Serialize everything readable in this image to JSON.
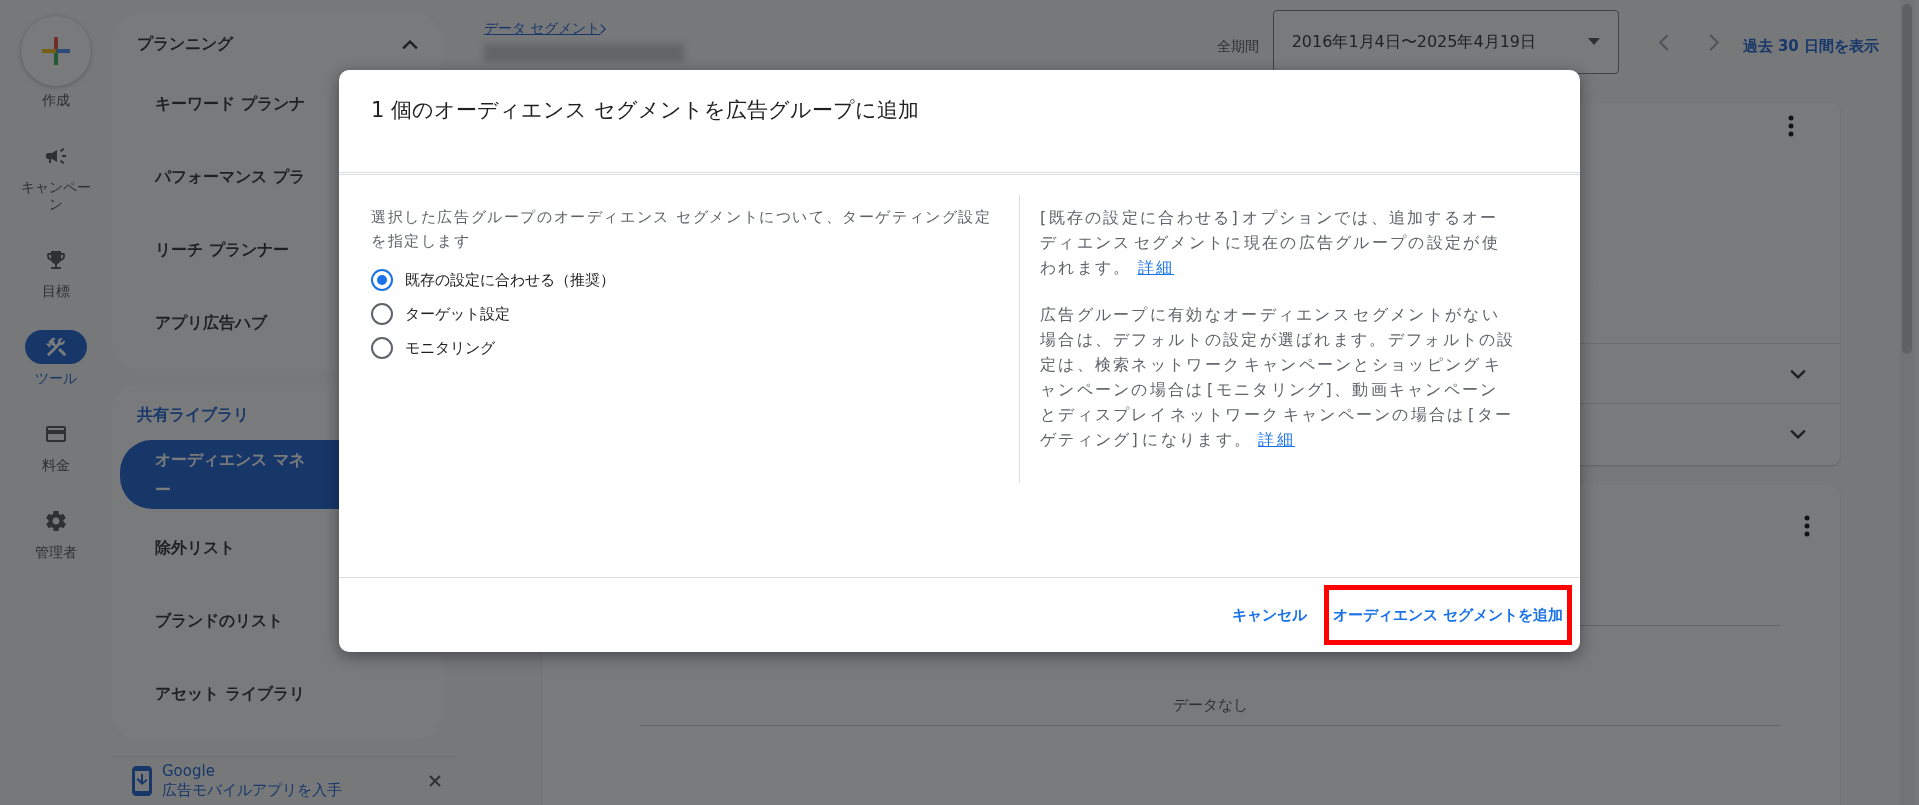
{
  "rail": {
    "items": [
      {
        "label": "作成",
        "selected": false
      },
      {
        "label": "キャンペーン",
        "selected": false
      },
      {
        "label": "目標",
        "selected": false
      },
      {
        "label": "ツール",
        "selected": true
      },
      {
        "label": "料金",
        "selected": false
      },
      {
        "label": "管理者",
        "selected": false
      }
    ]
  },
  "side_panel": {
    "sections": [
      {
        "title": "プランニング",
        "expanded": true,
        "items": [
          {
            "label_lines": [
              "キーワード プランナ"
            ],
            "selected": false
          },
          {
            "label_lines": [
              "パフォーマンス プラ"
            ],
            "selected": false
          },
          {
            "label_lines": [
              "リーチ プランナー"
            ],
            "selected": false
          },
          {
            "label_lines": [
              "アプリ広告ハブ"
            ],
            "selected": false
          }
        ]
      },
      {
        "title": "共有ライブラリ",
        "items": [
          {
            "label_lines": [
              "オーディエンス マネ",
              "ー"
            ],
            "selected": true
          },
          {
            "label_lines": [
              "除外リスト"
            ],
            "selected": false
          },
          {
            "label_lines": [
              "ブランドのリスト"
            ],
            "selected": false
          },
          {
            "label_lines": [
              "アセット ライブラリ"
            ],
            "selected": false
          }
        ]
      }
    ],
    "promo": {
      "title": "Google",
      "text": "広告モバイルアプリを入手"
    }
  },
  "header": {
    "breadcrumb": "データ セグメント",
    "date_label": "全期間",
    "date_range": "2016年1月4日〜2025年4月19日",
    "link": "過去 30 日間を表示"
  },
  "cards": {
    "empty_text": "データなし"
  },
  "dialog": {
    "title": "1 個のオーディエンス セグメントを広告グループに追加",
    "description": "選択した広告グループのオーディエンス セグメントについて、ターゲティング設定を指定します",
    "options": [
      {
        "label": "既存の設定に合わせる（推奨）",
        "selected": true
      },
      {
        "label": "ターゲット設定",
        "selected": false
      },
      {
        "label": "モニタリング",
        "selected": false
      }
    ],
    "help": [
      {
        "text": "[既存の設定に合わせる] オプションでは、追加するオーディエンス セグメントに現在の広告グループの設定が使われます。",
        "link": "詳細"
      },
      {
        "text": "広告グループに有効なオーディエンス セグメントがない場合は、デフォルトの設定が選ばれます。デフォルトの設定は、検索ネットワーク キャンペーンとショッピング キャンペーンの場合は [モニタリング]、動画キャンペーンとディスプレイ ネットワーク キャンペーンの場合は [ターゲティング] になります。",
        "link": "詳細"
      }
    ],
    "buttons": [
      {
        "label": "キャンセル",
        "highlighted": false
      },
      {
        "label": "オーディエンス セグメントを追加",
        "highlighted": true
      }
    ]
  }
}
